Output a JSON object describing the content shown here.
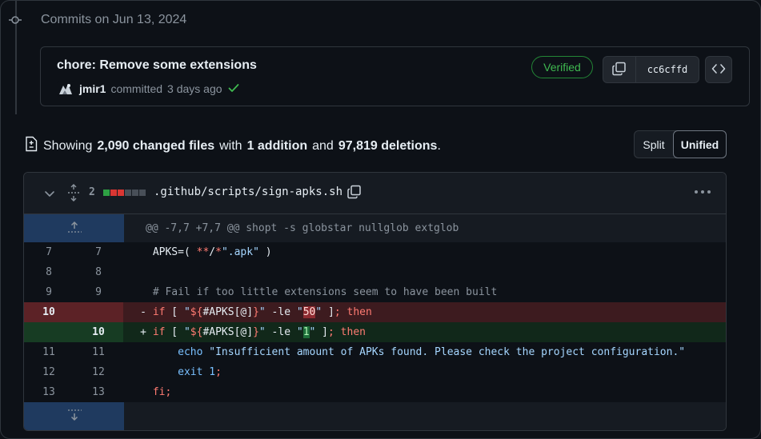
{
  "timeline": {
    "heading": "Commits on Jun 13, 2024"
  },
  "commit": {
    "title": "chore: Remove some extensions",
    "author": "jmir1",
    "action": "committed",
    "time": "3 days ago",
    "verified_label": "Verified",
    "sha": "cc6cffd",
    "icons": [
      "commit-node-icon",
      "avatar",
      "check-icon",
      "copy-icon",
      "code-icon"
    ]
  },
  "summary": {
    "prefix": "Showing",
    "files": "2,090 changed files",
    "with": "with",
    "additions": "1 addition",
    "and": "and",
    "deletions": "97,819 deletions",
    "suffix": "."
  },
  "view_toggle": {
    "split": "Split",
    "unified": "Unified",
    "selected": "Unified"
  },
  "file": {
    "changes_count": "2",
    "path": ".github/scripts/sign-apks.sh",
    "diffstat_colors": [
      "#2ea043",
      "#da3633",
      "#da3633",
      "#484f58",
      "#484f58",
      "#484f58"
    ],
    "hunk_header": "@@ -7,7 +7,7 @@ shopt -s globstar nullglob extglob",
    "lines": {
      "l7": {
        "old": "7",
        "new": "7"
      },
      "l8": {
        "old": "8",
        "new": "8"
      },
      "l9": {
        "old": "9",
        "new": "9",
        "text": "# Fail if too little extensions seem to have been built"
      },
      "del": {
        "old": "10",
        "new": "",
        "marker": "-",
        "old_value": "50"
      },
      "add": {
        "old": "",
        "new": "10",
        "marker": "+",
        "new_value": "1"
      },
      "l11": {
        "old": "11",
        "new": "11",
        "cmd": "echo",
        "text": "\"Insufficient amount of APKs found. Please check the project configuration.\""
      },
      "l12": {
        "old": "12",
        "new": "12",
        "cmd": "exit",
        "arg": "1"
      },
      "l13": {
        "old": "13",
        "new": "13",
        "text": "fi"
      }
    }
  },
  "colors": {
    "accent_green": "#3fb950",
    "deletion_bg": "#3d1b1f",
    "addition_bg": "#11281a",
    "expander_bg": "#1f3a5f"
  }
}
